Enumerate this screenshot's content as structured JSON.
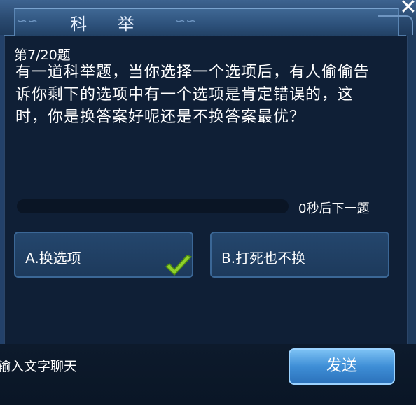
{
  "header": {
    "title": "科 举",
    "close_icon": "close-icon"
  },
  "question": {
    "number": "第7/20题",
    "text": "有一道科举题，当你选择一个选项后，有人偷偷告诉你剩下的选项中有一个选项是肯定错误的，这时，你是换答案好呢还是不换答案最优？"
  },
  "timer": {
    "progress": 0,
    "label": "0秒后下一题"
  },
  "options": [
    {
      "label": "A.换选项",
      "selected": true,
      "icon": "check-icon"
    },
    {
      "label": "B.打死也不换",
      "selected": false
    }
  ],
  "chat": {
    "placeholder": "输入文字聊天",
    "send_label": "发送"
  },
  "colors": {
    "accent": "#3a7fd0",
    "check": "#8fd12a"
  }
}
